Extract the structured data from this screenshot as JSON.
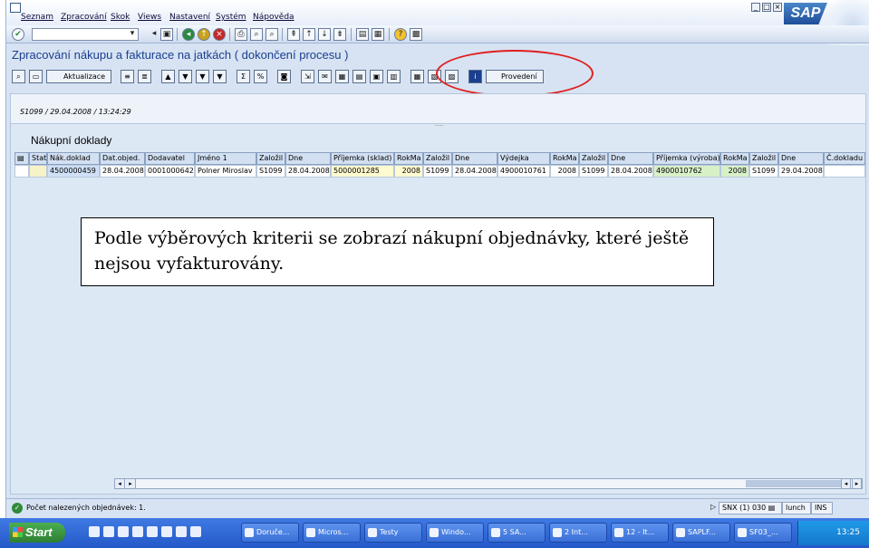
{
  "menu": [
    "Seznam",
    "Zpracování",
    "Skok",
    "Views",
    "Nastavení",
    "Systém",
    "Nápověda"
  ],
  "window_controls": [
    "_",
    "□",
    "×"
  ],
  "brand": "SAP",
  "title": "Zpracování nákupu a fakturace na jatkách ( dokončení procesu )",
  "app_toolbar": {
    "refresh_label": "Aktualizace",
    "execute_label": "Provedení"
  },
  "document_info": "S1099 / 29.04.2008 / 13:24:29",
  "grid": {
    "title": "Nákupní doklady",
    "columns": [
      "Stat",
      "Nák.doklad",
      "Dat.objed.",
      "Dodavatel",
      "Jméno 1",
      "Založil",
      "Dne",
      "Příjemka (sklad)",
      "RokMa",
      "Založil",
      "Dne",
      "Výdejka",
      "RokMa",
      "Založil",
      "Dne",
      "Příjemka (výroba)",
      "RokMa",
      "Založil",
      "Dne",
      "Č.dokladu F"
    ],
    "rows": [
      [
        "",
        "4500000459",
        "28.04.2008",
        "0001000642",
        "Polner Miroslav",
        "S1099",
        "28.04.2008",
        "5000001285",
        "2008",
        "S1099",
        "28.04.2008",
        "4900010761",
        "2008",
        "S1099",
        "28.04.2008",
        "4900010762",
        "2008",
        "S1099",
        "29.04.2008",
        ""
      ]
    ]
  },
  "callout": "Podle výběrových kriterii se zobrazí nákupní objednávky, které ještě nejsou vyfakturovány.",
  "status": {
    "message": "Počet nalezených objednávek: 1.",
    "system": "SNX (1) 030",
    "server": "lunch",
    "mode": "INS"
  },
  "taskbar": {
    "start": "Start",
    "tasks": [
      "Doruče...",
      "Micros...",
      "Testy",
      "Windo...",
      "5 SA...",
      "2 Int...",
      "12 - It...",
      "SAPLF...",
      "SF03_..."
    ],
    "clock": "13:25"
  },
  "colors": {
    "title": "#1b3f8f",
    "highlight_ellipse": "#e02020"
  }
}
